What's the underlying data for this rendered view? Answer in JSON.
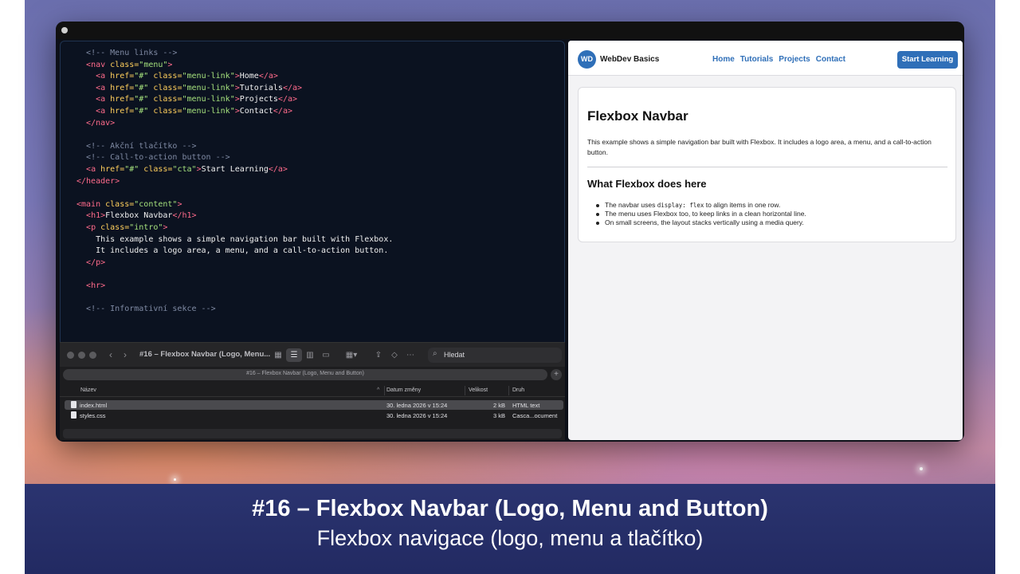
{
  "editor": {
    "lines": [
      {
        "indent": 2,
        "tokens": [
          {
            "t": "comment",
            "v": "<!-- Menu links -->"
          }
        ]
      },
      {
        "indent": 2,
        "tokens": [
          {
            "t": "tag",
            "v": "<nav"
          },
          {
            "t": "attr",
            "v": " class="
          },
          {
            "t": "str",
            "v": "\"menu\""
          },
          {
            "t": "tag",
            "v": ">"
          }
        ]
      },
      {
        "indent": 4,
        "tokens": [
          {
            "t": "tag",
            "v": "<a"
          },
          {
            "t": "attr",
            "v": " href="
          },
          {
            "t": "str",
            "v": "\"#\""
          },
          {
            "t": "attr",
            "v": " class="
          },
          {
            "t": "str",
            "v": "\"menu-link\""
          },
          {
            "t": "tag",
            "v": ">"
          },
          {
            "t": "text",
            "v": "Home"
          },
          {
            "t": "tag",
            "v": "</a>"
          }
        ]
      },
      {
        "indent": 4,
        "tokens": [
          {
            "t": "tag",
            "v": "<a"
          },
          {
            "t": "attr",
            "v": " href="
          },
          {
            "t": "str",
            "v": "\"#\""
          },
          {
            "t": "attr",
            "v": " class="
          },
          {
            "t": "str",
            "v": "\"menu-link\""
          },
          {
            "t": "tag",
            "v": ">"
          },
          {
            "t": "text",
            "v": "Tutorials"
          },
          {
            "t": "tag",
            "v": "</a>"
          }
        ]
      },
      {
        "indent": 4,
        "tokens": [
          {
            "t": "tag",
            "v": "<a"
          },
          {
            "t": "attr",
            "v": " href="
          },
          {
            "t": "str",
            "v": "\"#\""
          },
          {
            "t": "attr",
            "v": " class="
          },
          {
            "t": "str",
            "v": "\"menu-link\""
          },
          {
            "t": "tag",
            "v": ">"
          },
          {
            "t": "text",
            "v": "Projects"
          },
          {
            "t": "tag",
            "v": "</a>"
          }
        ]
      },
      {
        "indent": 4,
        "tokens": [
          {
            "t": "tag",
            "v": "<a"
          },
          {
            "t": "attr",
            "v": " href="
          },
          {
            "t": "str",
            "v": "\"#\""
          },
          {
            "t": "attr",
            "v": " class="
          },
          {
            "t": "str",
            "v": "\"menu-link\""
          },
          {
            "t": "tag",
            "v": ">"
          },
          {
            "t": "text",
            "v": "Contact"
          },
          {
            "t": "tag",
            "v": "</a>"
          }
        ]
      },
      {
        "indent": 2,
        "tokens": [
          {
            "t": "tag",
            "v": "</nav>"
          }
        ]
      },
      {
        "indent": 0,
        "tokens": []
      },
      {
        "indent": 2,
        "tokens": [
          {
            "t": "comment",
            "v": "<!-- Akční tlačítko -->"
          }
        ]
      },
      {
        "indent": 2,
        "tokens": [
          {
            "t": "comment",
            "v": "<!-- Call-to-action button -->"
          }
        ]
      },
      {
        "indent": 2,
        "tokens": [
          {
            "t": "tag",
            "v": "<a"
          },
          {
            "t": "attr",
            "v": " href="
          },
          {
            "t": "str",
            "v": "\"#\""
          },
          {
            "t": "attr",
            "v": " class="
          },
          {
            "t": "str",
            "v": "\"cta\""
          },
          {
            "t": "tag",
            "v": ">"
          },
          {
            "t": "text",
            "v": "Start Learning"
          },
          {
            "t": "tag",
            "v": "</a>"
          }
        ]
      },
      {
        "indent": 0,
        "tokens": [
          {
            "t": "tag",
            "v": "</header>"
          }
        ]
      },
      {
        "indent": 0,
        "tokens": []
      },
      {
        "indent": 0,
        "tokens": [
          {
            "t": "tag",
            "v": "<main"
          },
          {
            "t": "attr",
            "v": " class="
          },
          {
            "t": "str",
            "v": "\"content\""
          },
          {
            "t": "tag",
            "v": ">"
          }
        ]
      },
      {
        "indent": 2,
        "tokens": [
          {
            "t": "tag",
            "v": "<h1>"
          },
          {
            "t": "text",
            "v": "Flexbox Navbar"
          },
          {
            "t": "tag",
            "v": "</h1>"
          }
        ]
      },
      {
        "indent": 2,
        "tokens": [
          {
            "t": "tag",
            "v": "<p"
          },
          {
            "t": "attr",
            "v": " class="
          },
          {
            "t": "str",
            "v": "\"intro\""
          },
          {
            "t": "tag",
            "v": ">"
          }
        ]
      },
      {
        "indent": 4,
        "tokens": [
          {
            "t": "text",
            "v": "This example shows a simple navigation bar built with Flexbox."
          }
        ]
      },
      {
        "indent": 4,
        "tokens": [
          {
            "t": "text",
            "v": "It includes a logo area, a menu, and a call-to-action button."
          }
        ]
      },
      {
        "indent": 2,
        "tokens": [
          {
            "t": "tag",
            "v": "</p>"
          }
        ]
      },
      {
        "indent": 0,
        "tokens": []
      },
      {
        "indent": 2,
        "tokens": [
          {
            "t": "tag",
            "v": "<hr>"
          }
        ]
      },
      {
        "indent": 0,
        "tokens": []
      },
      {
        "indent": 2,
        "tokens": [
          {
            "t": "comment",
            "v": "<!-- Informativní sekce -->"
          }
        ]
      }
    ]
  },
  "finder": {
    "title": "#16 – Flexbox Navbar (Logo, Menu...",
    "search_label": "Hledat",
    "path_text": "#16 – Flexbox Navbar (Logo, Menu and Button)",
    "columns": {
      "name": "Název",
      "date": "Datum změny",
      "size": "Velikost",
      "kind": "Druh"
    },
    "files": [
      {
        "name": "index.html",
        "date": "30. ledna 2026 v 15:24",
        "size": "2 kB",
        "kind": "HTML text",
        "selected": true
      },
      {
        "name": "styles.css",
        "date": "30. ledna 2026 v 15:24",
        "size": "3 kB",
        "kind": "Casca...ocument",
        "selected": false
      }
    ]
  },
  "preview": {
    "logo": "WD",
    "brand": "WebDev Basics",
    "menu": [
      "Home",
      "Tutorials",
      "Projects",
      "Contact"
    ],
    "cta": "Start Learning",
    "h1": "Flexbox Navbar",
    "intro": "This example shows a simple navigation bar built with Flexbox. It includes a logo area, a menu, and a call-to-action button.",
    "h2": "What Flexbox does here",
    "list": [
      {
        "before": "The navbar uses ",
        "code": "display: flex",
        "after": " to align items in one row."
      },
      {
        "before": "The menu uses Flexbox too, to keep links in a clean horizontal line.",
        "code": "",
        "after": ""
      },
      {
        "before": "On small screens, the layout stacks vertically using a media query.",
        "code": "",
        "after": ""
      }
    ]
  },
  "caption": {
    "title": "#16 – Flexbox Navbar (Logo, Menu and Button)",
    "subtitle": "Flexbox navigace (logo, menu a tlačítko)"
  },
  "colors": {
    "accent": "#2f6fb8",
    "caption_band": "#2b3470"
  }
}
